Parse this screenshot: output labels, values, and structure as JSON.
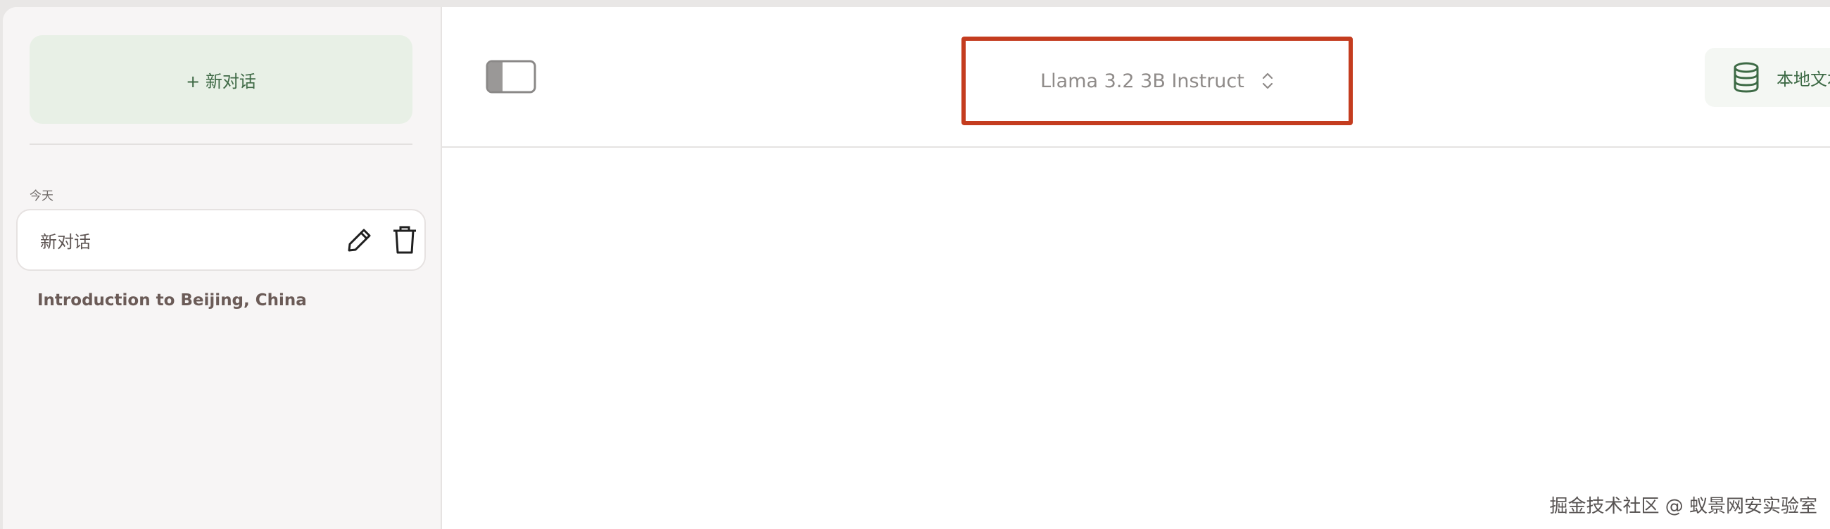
{
  "sidebar": {
    "new_chat_label": "+ 新对话",
    "section_today": "今天",
    "items": [
      {
        "label": "新对话"
      },
      {
        "label": "Introduction to Beijing, China"
      }
    ]
  },
  "header": {
    "model_name": "Llama 3.2 3B Instruct",
    "kb_label": "本地文本"
  },
  "watermark": "掘金技术社区 @ 蚁景网安实验室",
  "colors": {
    "accent_green": "#3f6a46",
    "highlight_border": "#c43c1f"
  },
  "icons": {
    "edit": "pencil-icon",
    "delete": "trash-icon",
    "toggle": "sidebar-toggle-icon",
    "chevron": "chevron-updown-icon",
    "database": "database-icon"
  }
}
